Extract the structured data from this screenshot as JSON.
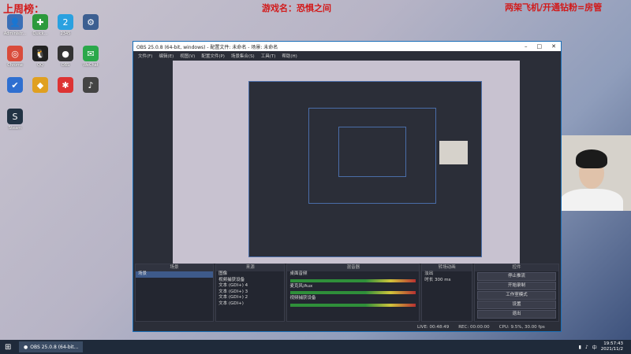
{
  "overlays": {
    "top_left": "上周榜：",
    "game_name": "游戏名：恐惧之间",
    "top_right": "两架飞机/开通钻粉=房管"
  },
  "desktop_icons": [
    {
      "label": "Administr...",
      "glyph": "👤",
      "color": "#3b6fb6"
    },
    {
      "label": "Quick...",
      "glyph": "✚",
      "color": "#2c9a3c"
    },
    {
      "label": "2345",
      "glyph": "2",
      "color": "#2aa1e0"
    },
    {
      "label": "",
      "glyph": "⚙",
      "color": "#3c5f91"
    },
    {
      "label": "Chrome",
      "glyph": "◎",
      "color": "#d94b3a"
    },
    {
      "label": "QQ",
      "glyph": "🐧",
      "color": "#222"
    },
    {
      "label": "OBS",
      "glyph": "●",
      "color": "#333"
    },
    {
      "label": "WeChat",
      "glyph": "✉",
      "color": "#2aa84a"
    },
    {
      "label": "",
      "glyph": "✔",
      "color": "#2f6fd0"
    },
    {
      "label": "",
      "glyph": "◆",
      "color": "#e0a020"
    },
    {
      "label": "",
      "glyph": "✱",
      "color": "#d33"
    },
    {
      "label": "",
      "glyph": "♪",
      "color": "#444"
    },
    {
      "label": "Steam",
      "glyph": "S",
      "color": "#234"
    }
  ],
  "obs": {
    "title": "OBS 25.0.8 (64-bit, windows) - 配置文件: 未命名 - 场景: 未命名",
    "menu": [
      "文件(F)",
      "编辑(E)",
      "视图(V)",
      "配置文件(P)",
      "场景集合(S)",
      "工具(T)",
      "帮助(H)"
    ],
    "panels": {
      "scenes_header": "场景",
      "scenes": [
        "场景"
      ],
      "sources_header": "来源",
      "sources": [
        "图像",
        "视频捕获设备",
        "文本 (GDI+) 4",
        "文本 (GDI+) 3",
        "文本 (GDI+) 2",
        "文本 (GDI+)"
      ],
      "mixer_header": "混音器",
      "mixer": [
        "桌面音频",
        "麦克风/Aux",
        "视频捕获设备"
      ],
      "transitions_header": "转场动画",
      "transition": "淡出",
      "duration_label": "时长",
      "duration": "300 ms",
      "controls_header": "控件",
      "controls": [
        "停止推流",
        "开始录制",
        "工作室模式",
        "设置",
        "退出"
      ]
    },
    "status": {
      "live": "LIVE: 00:48:49",
      "rec": "REC: 00:00:00",
      "cpu": "CPU: 9.5%, 30.00 fps"
    }
  },
  "taskbar": {
    "app_button": "OBS 25.0.8 (64-bit...",
    "time": "19:57:43",
    "date": "2021/11/2"
  }
}
